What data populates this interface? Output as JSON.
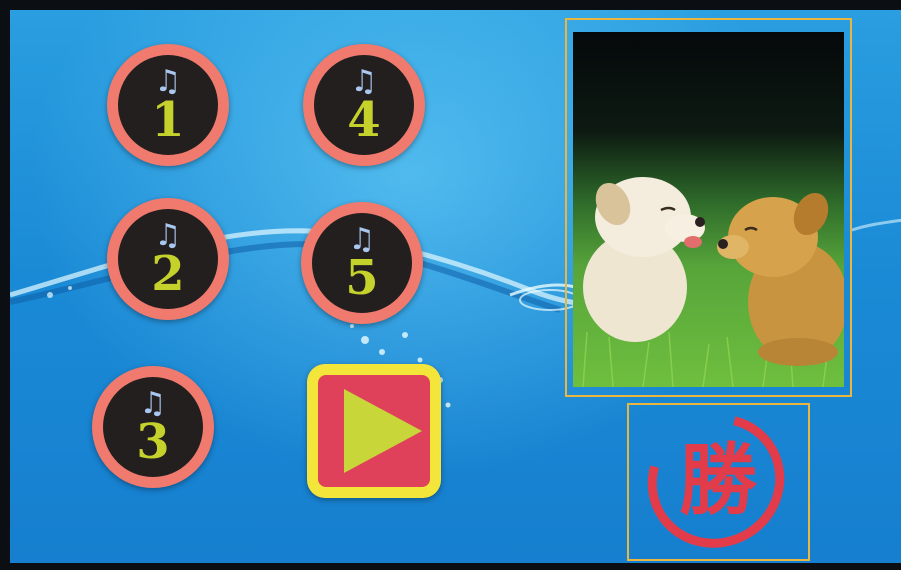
{
  "note_icon": "music-note-icon",
  "sound_buttons": [
    {
      "number": "1",
      "icon": "♫"
    },
    {
      "number": "2",
      "icon": "♫"
    },
    {
      "number": "3",
      "icon": "♫"
    },
    {
      "number": "4",
      "icon": "♫"
    },
    {
      "number": "5",
      "icon": "♫"
    }
  ],
  "play_icon": "play-icon",
  "win_seal": {
    "character": "勝"
  },
  "colors": {
    "background": "#1b8bd6",
    "button_ring": "#f07a6e",
    "button_face": "#231f1f",
    "digit": "#c6d22c",
    "note": "#a9c7ef",
    "play_outer": "#f4e53a",
    "play_inner": "#e0415a",
    "play_triangle": "#c8d63a",
    "frame_border": "#e9b640",
    "seal_red": "#e23c4a"
  }
}
